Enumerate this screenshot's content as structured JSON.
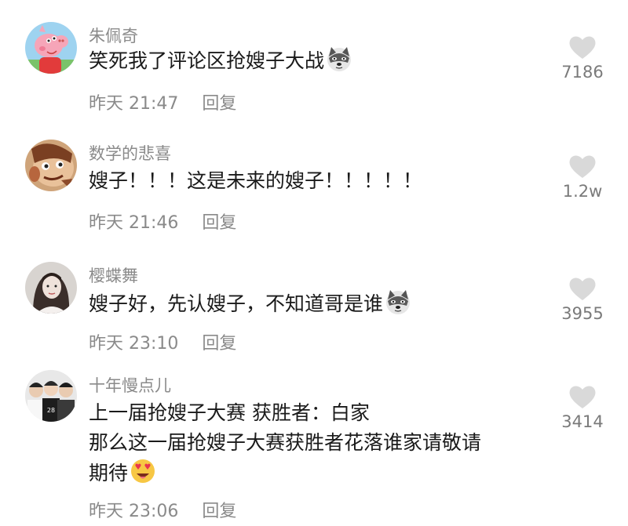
{
  "comments": [
    {
      "avatar_icon": "peppa-pig-avatar-icon",
      "username": "朱佩奇",
      "text": "笑死我了评论区抢嫂子大战",
      "emoji": "husky-emoji-icon",
      "time": "昨天 21:47",
      "reply_label": "回复",
      "likes": "7186"
    },
    {
      "avatar_icon": "cartoon-face-avatar-icon",
      "username": "数学的悲喜",
      "text": "嫂子！！！这是未来的嫂子！！！！！",
      "time": "昨天 21:46",
      "reply_label": "回复",
      "likes": "1.2w"
    },
    {
      "avatar_icon": "woman-photo-avatar-icon",
      "username": "樱蝶舞",
      "text": "嫂子好，先认嫂子，不知道哥是谁",
      "emoji": "husky-emoji-icon",
      "time": "昨天 23:10",
      "reply_label": "回复",
      "likes": "3955"
    },
    {
      "avatar_icon": "group-photo-avatar-icon",
      "username": "十年慢点儿",
      "text_lines": [
        "上一届抢嫂子大赛 获胜者：白家",
        "那么这一届抢嫂子大赛获胜者花落谁家请敬请",
        "期待"
      ],
      "emoji": "heart-eyes-emoji-icon",
      "time": "昨天 23:06",
      "reply_label": "回复",
      "likes": "3414"
    }
  ],
  "colors": {
    "meta_text": "#8a8a8a",
    "content_text": "#1a1a1a",
    "heart": "#d9d9d9"
  }
}
